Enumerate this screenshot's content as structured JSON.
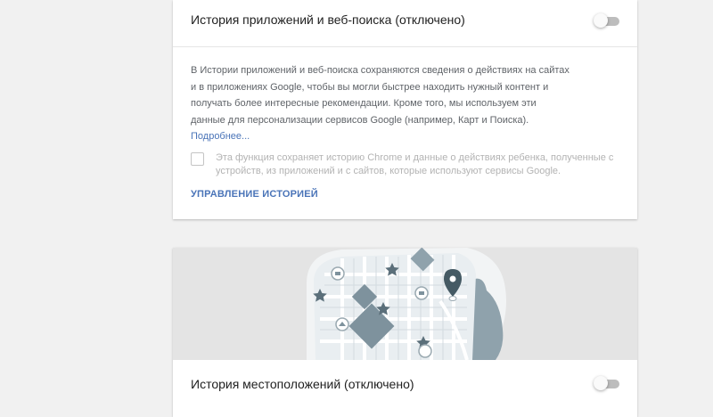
{
  "web_app_activity": {
    "title": "История приложений и веб-поиска (отключено)",
    "toggle_state": "off",
    "description_lines": [
      "В Истории приложений и веб-поиска сохраняются сведения о действиях на сайтах",
      "и в приложениях Google, чтобы вы могли быстрее находить нужный контент и",
      "получать более интересные рекомендации. Кроме того, мы используем эти",
      "данные для персонализации сервисов Google (например, Карт и Поиска)."
    ],
    "more_link": "Подробнее...",
    "chrome_checkbox_lines": [
      "Эта функция сохраняет историю Chrome и данные о действиях ребенка, полученные с",
      "устройств, из приложений и с сайтов, которые используют сервисы Google."
    ],
    "chrome_checkbox_checked": false,
    "manage_link": "Управление историей"
  },
  "location_history": {
    "title": "История местоположений (отключено)",
    "toggle_state": "off",
    "illustration": "map-illustration"
  },
  "colors": {
    "background": "#f1f1f1",
    "card": "#ffffff",
    "link": "#4a74b8",
    "map_land": "#e9eef1",
    "map_block": "#7e929d",
    "map_water": "#8fa2ac"
  }
}
